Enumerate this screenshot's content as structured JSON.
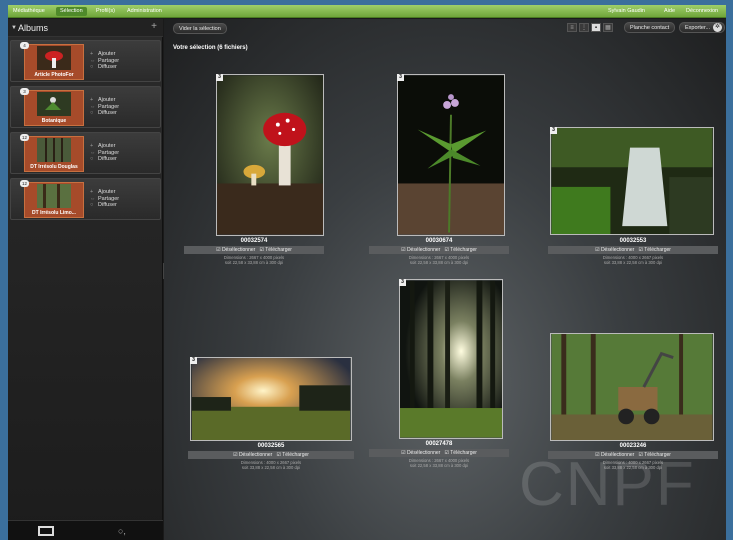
{
  "menu": {
    "items": [
      "Médiathèque",
      "Sélection",
      "Profil(s)",
      "Administration"
    ],
    "right_items": [
      "Sylvain Gaudin",
      "Aide",
      "Déconnexion"
    ]
  },
  "sidebar": {
    "title": "Albums",
    "albums": [
      {
        "label": "Article PhotoFor",
        "count": "4",
        "actions": [
          "Ajouter",
          "Partager",
          "Diffuser"
        ]
      },
      {
        "label": "Botanique",
        "count": "3",
        "actions": [
          "Ajouter",
          "Partager",
          "Diffuser"
        ]
      },
      {
        "label": "DT Irrésolu Douglas",
        "count": "12",
        "actions": [
          "Ajouter",
          "Partager",
          "Diffuser"
        ]
      },
      {
        "label": "DT Irrésolu Limo...",
        "count": "12",
        "actions": [
          "Ajouter",
          "Partager",
          "Diffuser"
        ]
      }
    ]
  },
  "toolbar": {
    "clear_label": "Vider la sélection",
    "contact_sheet_label": "Planche contact",
    "export_label": "Exporter..."
  },
  "selection_title": "Votre sélection (6 fichiers)",
  "cards": [
    {
      "id": "00032574",
      "badge": "3",
      "deselect": "Désélectionner",
      "download": "Télécharger",
      "meta1": "Dimensions : 2667 x 4000 pixels",
      "meta2": "soit 22,58 x 33,88 cm à 300 dpi"
    },
    {
      "id": "00030674",
      "badge": "3",
      "deselect": "Désélectionner",
      "download": "Télécharger",
      "meta1": "Dimensions : 2667 x 4000 pixels",
      "meta2": "soit 22,58 x 33,88 cm à 300 dpi"
    },
    {
      "id": "00032553",
      "badge": "3",
      "deselect": "Désélectionner",
      "download": "Télécharger",
      "meta1": "Dimensions : 4000 x 2667 pixels",
      "meta2": "soit 33,88 x 22,58 cm à 300 dpi"
    },
    {
      "id": "00032565",
      "badge": "3",
      "deselect": "Désélectionner",
      "download": "Télécharger",
      "meta1": "Dimensions : 4000 x 2667 pixels",
      "meta2": "soit 33,88 x 22,58 cm à 300 dpi"
    },
    {
      "id": "00027478",
      "badge": "3",
      "deselect": "Désélectionner",
      "download": "Télécharger",
      "meta1": "Dimensions : 2667 x 4000 pixels",
      "meta2": "soit 22,58 x 33,88 cm à 300 dpi"
    },
    {
      "id": "00023246",
      "badge": "3",
      "deselect": "Désélectionner",
      "download": "Télécharger",
      "meta1": "Dimensions : 4000 x 2667 pixels",
      "meta2": "soit 33,88 x 22,58 cm à 300 dpi"
    }
  ],
  "watermark": "CNPF"
}
